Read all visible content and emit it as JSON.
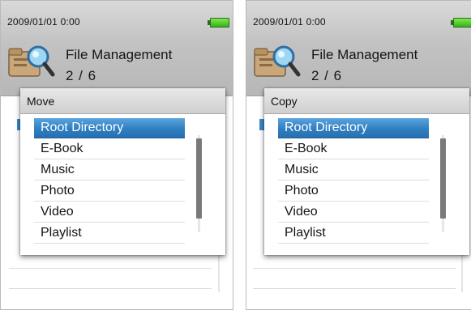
{
  "status": {
    "datetime": "2009/01/01   0:00"
  },
  "app": {
    "title": "File Management",
    "page": "2 / 6"
  },
  "colors": {
    "selection": "#2f7fc2",
    "battery": "#36b31c",
    "header": "#c2c2c2"
  },
  "screens": [
    {
      "dialog": {
        "title": "Move",
        "options": [
          "Root Directory",
          "E-Book",
          "Music",
          "Photo",
          "Video",
          "Playlist"
        ],
        "selected": "Root Directory"
      }
    },
    {
      "dialog": {
        "title": "Copy",
        "options": [
          "Root Directory",
          "E-Book",
          "Music",
          "Photo",
          "Video",
          "Playlist"
        ],
        "selected": "Root Directory"
      }
    }
  ]
}
